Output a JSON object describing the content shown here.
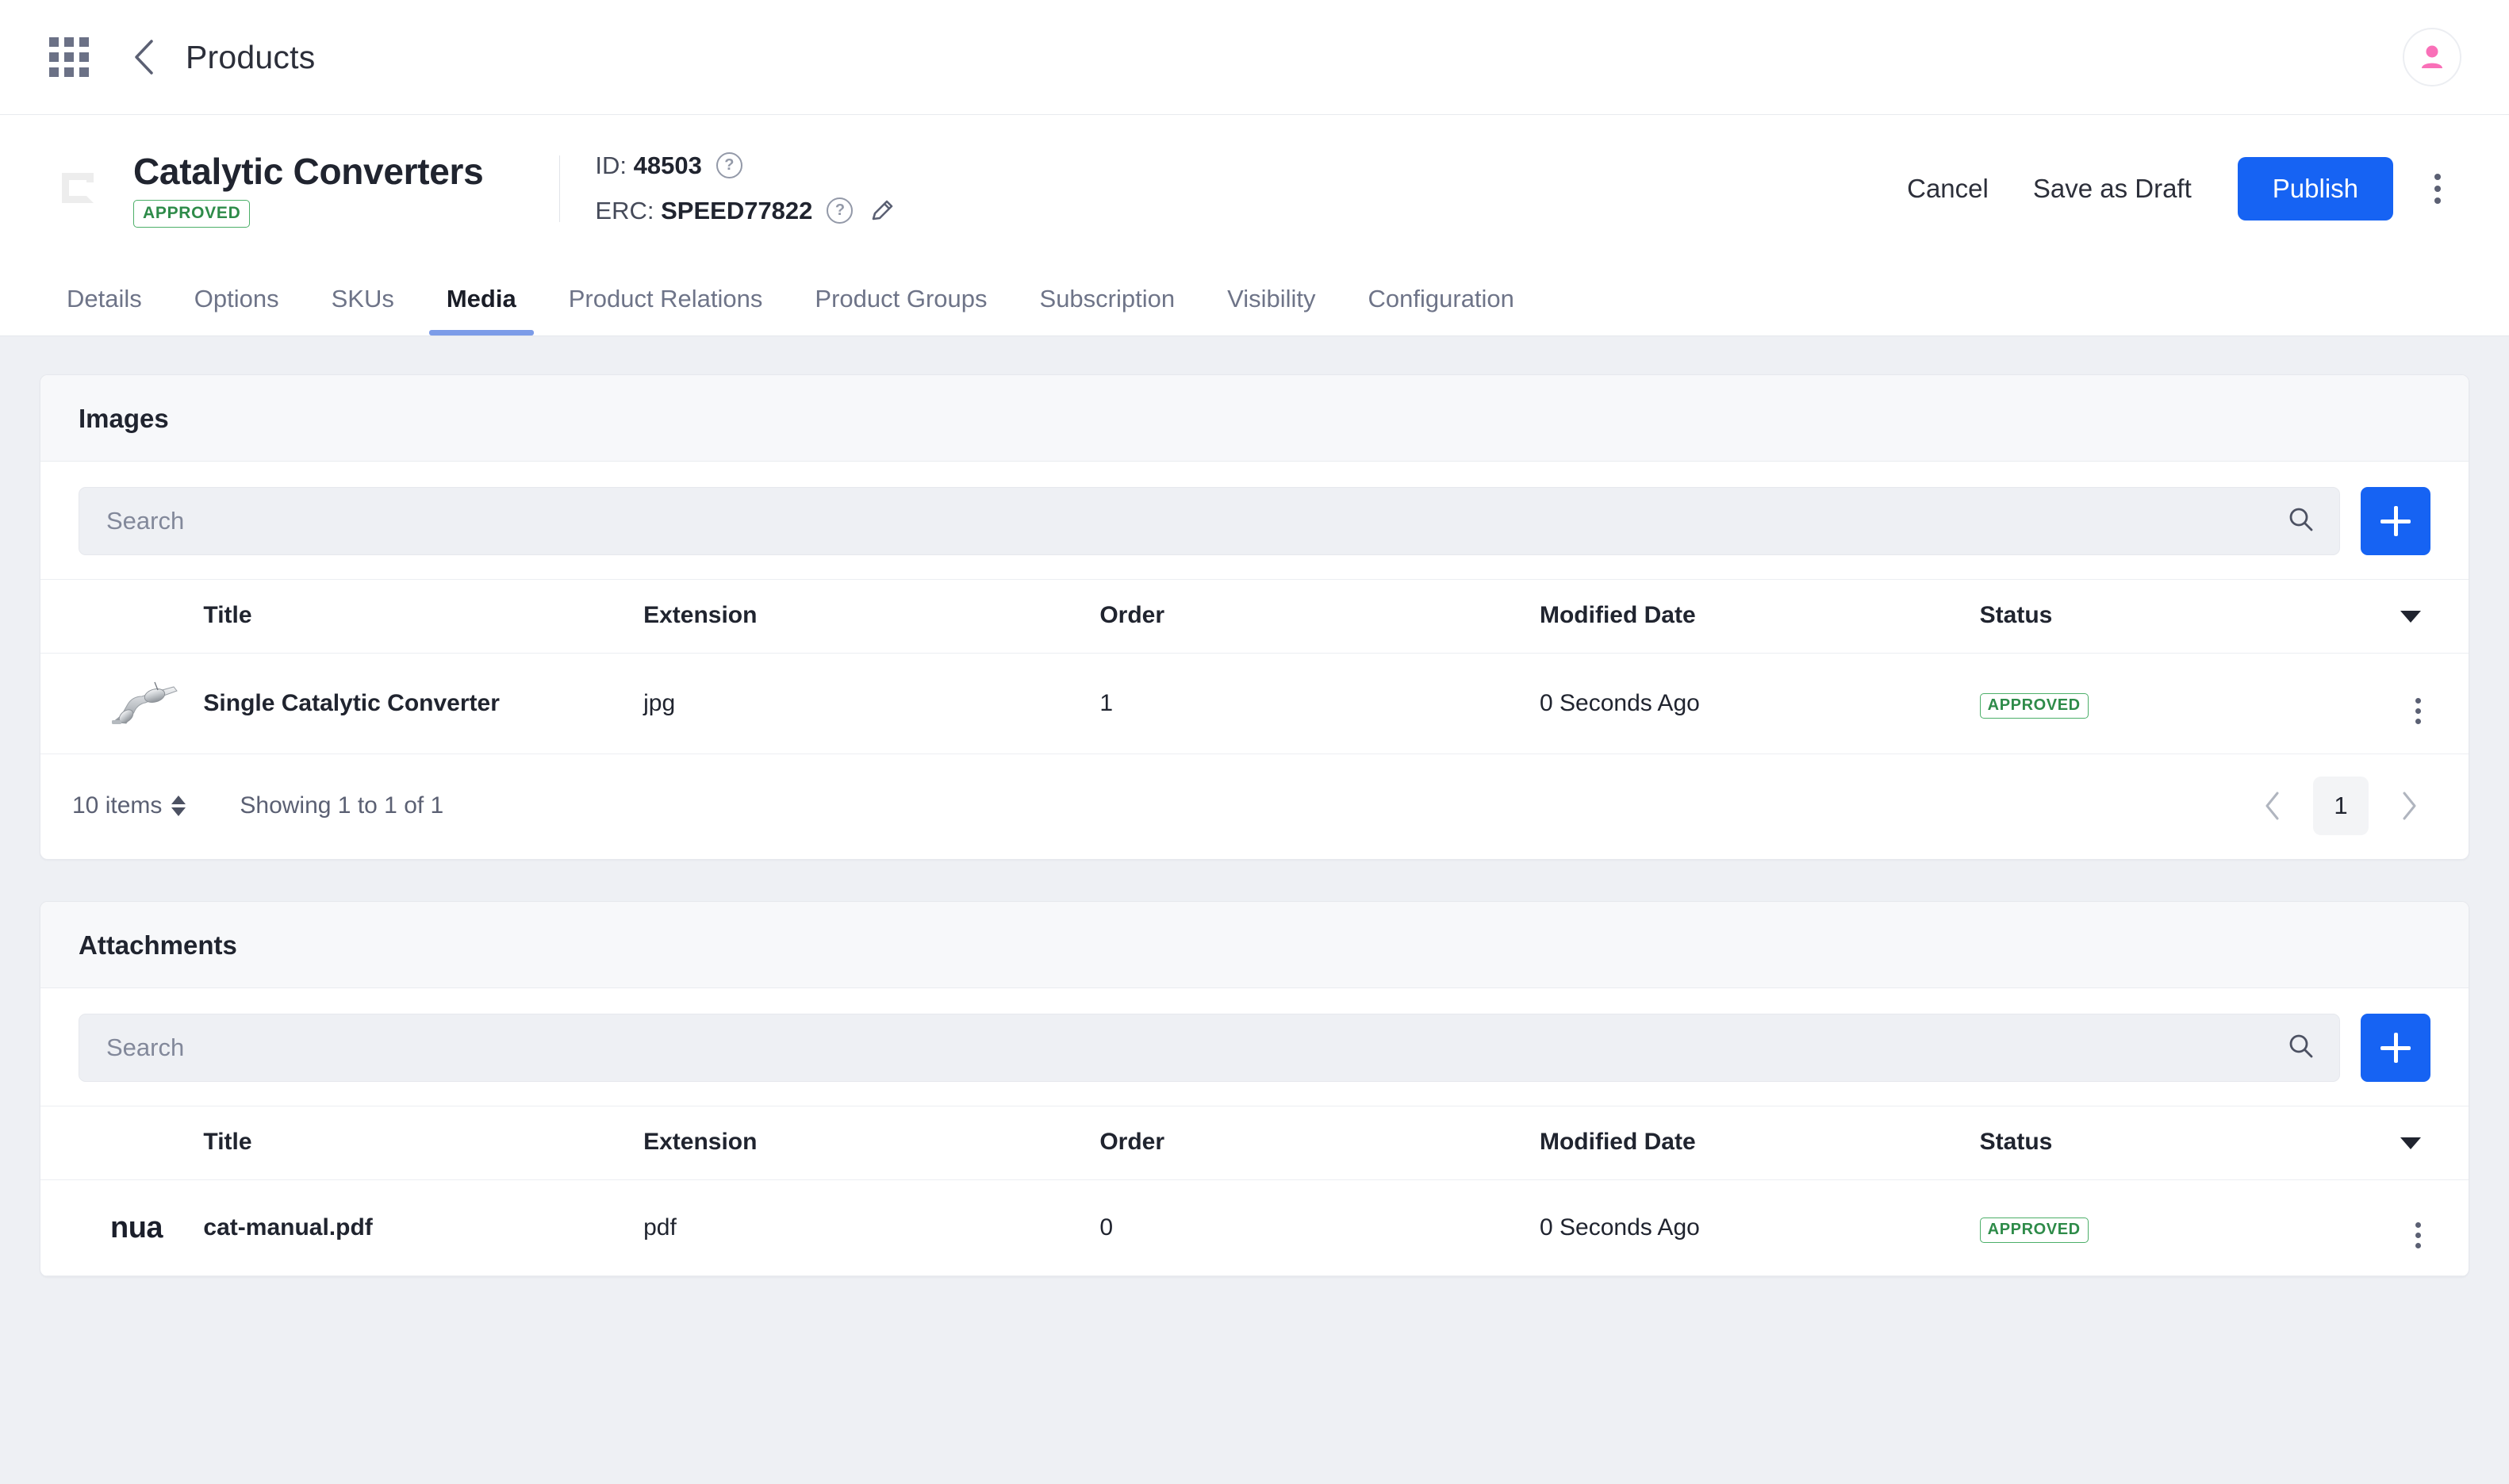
{
  "topbar": {
    "apps_icon": "grid-apps-icon",
    "back_icon": "chevron-left-icon",
    "breadcrumb": "Products",
    "avatar_icon": "user-avatar-icon"
  },
  "product_header": {
    "thumbnail_icon": "broken-image-placeholder-icon",
    "title": "Catalytic Converters",
    "status_badge": "APPROVED",
    "id_label": "ID:",
    "id_value": "48503",
    "erc_label": "ERC:",
    "erc_value": "SPEED77822",
    "help_icon": "question-mark-circle-icon",
    "edit_icon": "pencil-edit-icon",
    "actions": {
      "cancel": "Cancel",
      "save_as_draft": "Save as Draft",
      "publish": "Publish",
      "more_icon": "kebab-menu-icon"
    }
  },
  "tabs": [
    {
      "label": "Details",
      "active": false
    },
    {
      "label": "Options",
      "active": false
    },
    {
      "label": "SKUs",
      "active": false
    },
    {
      "label": "Media",
      "active": true
    },
    {
      "label": "Product Relations",
      "active": false
    },
    {
      "label": "Product Groups",
      "active": false
    },
    {
      "label": "Subscription",
      "active": false
    },
    {
      "label": "Visibility",
      "active": false
    },
    {
      "label": "Configuration",
      "active": false
    }
  ],
  "images_panel": {
    "title": "Images",
    "search": {
      "value": "",
      "placeholder": "Search",
      "icon": "search-icon"
    },
    "add_button_icon": "plus-icon",
    "columns": [
      "",
      "Title",
      "Extension",
      "Order",
      "Modified Date",
      "Status",
      ""
    ],
    "sort_icon": "caret-down-icon",
    "rows": [
      {
        "thumbnail_icon": "catalytic-converter-photo",
        "title": "Single Catalytic Converter",
        "extension": "jpg",
        "order": "1",
        "modified_date": "0 Seconds Ago",
        "status": "APPROVED",
        "row_menu_icon": "kebab-menu-icon"
      }
    ],
    "footer": {
      "page_size": "10 items",
      "page_size_icon": "up-down-arrows-icon",
      "showing": "Showing 1 to 1 of 1",
      "prev_icon": "chevron-left-icon",
      "next_icon": "chevron-right-icon",
      "current_page": "1"
    }
  },
  "attachments_panel": {
    "title": "Attachments",
    "search": {
      "value": "",
      "placeholder": "Search",
      "icon": "search-icon"
    },
    "add_button_icon": "plus-icon",
    "columns": [
      "",
      "Title",
      "Extension",
      "Order",
      "Modified Date",
      "Status",
      ""
    ],
    "sort_icon": "caret-down-icon",
    "rows": [
      {
        "thumbnail_text": "nua",
        "title": "cat-manual.pdf",
        "extension": "pdf",
        "order": "0",
        "modified_date": "0 Seconds Ago",
        "status": "APPROVED",
        "row_menu_icon": "kebab-menu-icon"
      }
    ]
  },
  "colors": {
    "accent_blue": "#1663f3",
    "tab_underline": "#7c9ce8",
    "status_green": "#2e8b49",
    "avatar_pink": "#f970b8",
    "page_bg": "#eef0f4"
  }
}
